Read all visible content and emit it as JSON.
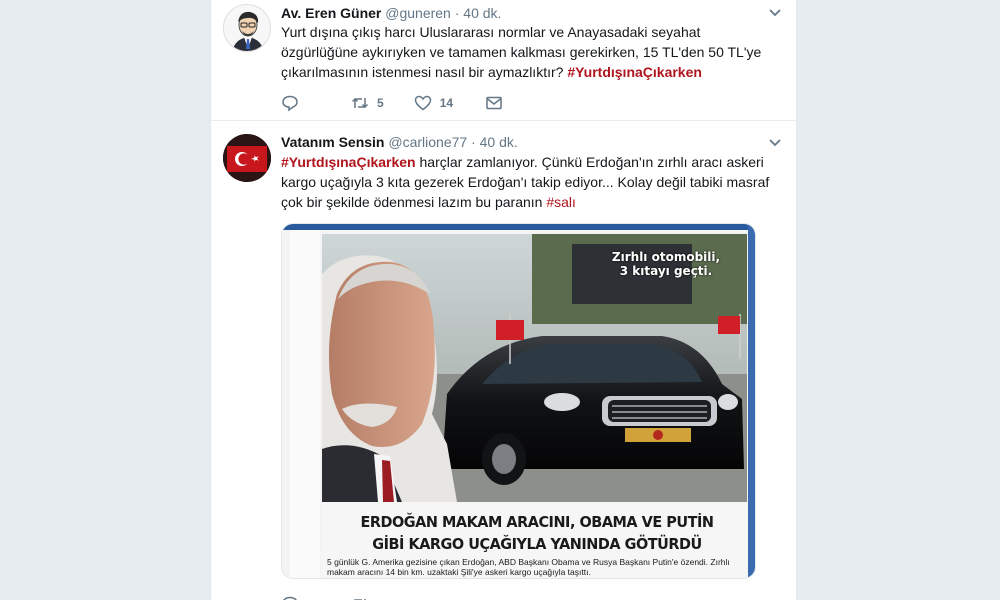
{
  "tweets": [
    {
      "name": "Av. Eren Güner",
      "handle": "@guneren",
      "separator": "·",
      "time": "40 dk.",
      "text": "Yurt dışına çıkış harcı Uluslararası normlar ve Anayasadaki seyahat özgürlüğüne aykırıyken ve tamamen kalkması gerekirken, 15 TL'den 50 TL'ye çıkarılmasının istenmesi nasıl bir aymazlıktır? ",
      "hashtag": "#YurtdışınaÇıkarken",
      "retweets": "5",
      "likes": "14"
    },
    {
      "name": "Vatanım Sensin",
      "handle": "@carlione77",
      "separator": "·",
      "time": "40 dk.",
      "hashtag": "#YurtdışınaÇıkarken",
      "text": " harçlar zamlanıyor. Çünkü Erdoğan'ın zırhlı aracı askeri kargo uçağıyla 3 kıta gezerek Erdoğan'ı takip ediyor... Kolay değil tabiki masraf çok bir şekilde ödenmesi lazım bu paranın ",
      "hashtag2": "#salı",
      "media": {
        "overlay": "Zırhlı otomobili, 3 kıtayı geçti.",
        "headline_line1": "ERDOĞAN MAKAM ARACINI, OBAMA VE PUTİN",
        "headline_line2": "GİBİ KARGO UÇAĞIYLA YANINDA GÖTÜRDÜ",
        "caption": "5 günlük G. Amerika gezisine çıkan Erdoğan, ABD Başkanı Obama ve Rusya Başkanı Putin'e özendi. Zırhlı makam aracını 14 bin km. uzaktaki Şili'ye askeri kargo uçağıyla taşıttı."
      }
    }
  ],
  "colors": {
    "hashtag": "#b0141c",
    "background": "#e6ecf0",
    "muted": "#657786"
  },
  "icons": [
    "reply-icon",
    "retweet-icon",
    "like-icon",
    "message-icon",
    "chevron-down-icon"
  ]
}
